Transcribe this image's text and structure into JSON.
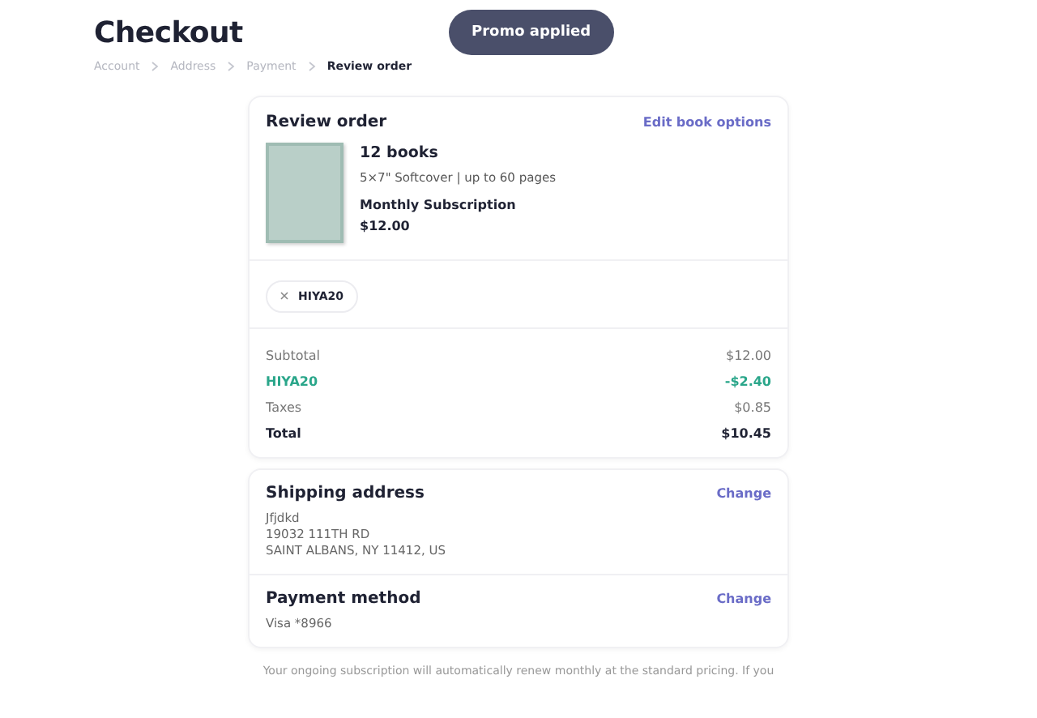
{
  "header": {
    "title": "Checkout",
    "toast": "Promo applied"
  },
  "breadcrumbs": [
    {
      "label": "Account",
      "selected": false
    },
    {
      "label": "Address",
      "selected": false
    },
    {
      "label": "Payment",
      "selected": false
    },
    {
      "label": "Review order",
      "selected": true
    }
  ],
  "review": {
    "title": "Review order",
    "action": "Edit book options",
    "product": {
      "name": "12 books",
      "details": "5×7\" Softcover | up to 60 pages",
      "plan": "Monthly Subscription",
      "price": "$12.00"
    }
  },
  "promo_chip": {
    "code": "HIYA20"
  },
  "totals": [
    {
      "kind": "plain",
      "label": "Subtotal",
      "value": "$12.00"
    },
    {
      "kind": "discount",
      "label": "HIYA20",
      "value": "-$2.40"
    },
    {
      "kind": "plain",
      "label": "Taxes",
      "value": "$0.85"
    },
    {
      "kind": "total",
      "label": "Total",
      "value": "$10.45"
    }
  ],
  "shipping": {
    "title": "Shipping address",
    "action": "Change",
    "lines": [
      "Jfjdkd",
      "19032 111TH RD",
      "SAINT ALBANS, NY 11412, US"
    ]
  },
  "payment": {
    "title": "Payment method",
    "action": "Change",
    "lines": [
      "Visa *8966"
    ]
  },
  "footer_note": "Your ongoing subscription will automatically renew monthly at the standard pricing. If you"
}
